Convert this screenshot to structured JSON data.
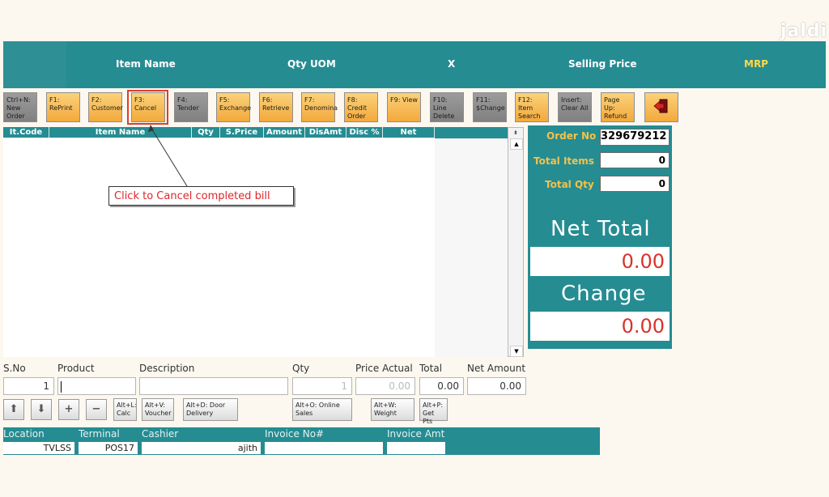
{
  "watermark": "jaldi",
  "header": {
    "columns": [
      "Item Name",
      "Qty UOM",
      "X",
      "Selling Price",
      "MRP"
    ]
  },
  "toolbar": [
    {
      "label": "Ctrl+N: New Order"
    },
    {
      "label": "F1: RePrint"
    },
    {
      "label": "F2: Customer"
    },
    {
      "label": "F3: Cancel"
    },
    {
      "label": "F4: Tender"
    },
    {
      "label": "F5: Exchange"
    },
    {
      "label": "F6: Retrieve"
    },
    {
      "label": "F7: Denomina"
    },
    {
      "label": "F8: Credit Order"
    },
    {
      "label": "F9: View"
    },
    {
      "label": "F10: Line Delete"
    },
    {
      "label": "F11: $Change"
    },
    {
      "label": "F12: Item Search"
    },
    {
      "label": "Insert: Clear All"
    },
    {
      "label": "Page Up: Refund"
    },
    {
      "icon": "exit-icon"
    }
  ],
  "callout": "Click to Cancel completed bill",
  "grid": {
    "columns": [
      "It.Code",
      "Item Name",
      "Qty",
      "S.Price",
      "Amount",
      "DisAmt",
      "Disc %",
      "Net Amount"
    ]
  },
  "summary": {
    "order_no_label": "Order No",
    "order_no": "329679212",
    "total_items_label": "Total Items",
    "total_items": "0",
    "total_qty_label": "Total Qty",
    "total_qty": "0",
    "net_total_label": "Net Total",
    "net_total": "0.00",
    "change_label": "Change",
    "change": "0.00"
  },
  "entry": {
    "labels": [
      "S.No",
      "Product",
      "Description",
      "Qty",
      "Price Actual",
      "Total",
      "Net Amount"
    ],
    "sno": "1",
    "product": "",
    "description": "",
    "qty_placeholder": "1",
    "price_actual_placeholder": "0.00",
    "total": "0.00",
    "net_amount": "0.00"
  },
  "actions": [
    {
      "label": "Alt+L: Calc"
    },
    {
      "label": "Alt+V: Voucher"
    },
    {
      "label": "Alt+D: Door Delivery"
    },
    {
      "label": "Alt+O: Online Sales"
    },
    {
      "label": "Alt+W: Weight"
    },
    {
      "label": "Alt+P: Get Pts"
    }
  ],
  "footer": {
    "labels": [
      "Location",
      "Terminal",
      "Cashier",
      "Invoice No#",
      "Invoice Amt"
    ],
    "location": "TVLSS",
    "terminal": "POS17",
    "cashier": "ajith",
    "invoice_no": "",
    "invoice_amt": ""
  },
  "colors": {
    "teal": "#258c92",
    "accent_yellow": "#ffd84a",
    "red": "#d9332a"
  }
}
